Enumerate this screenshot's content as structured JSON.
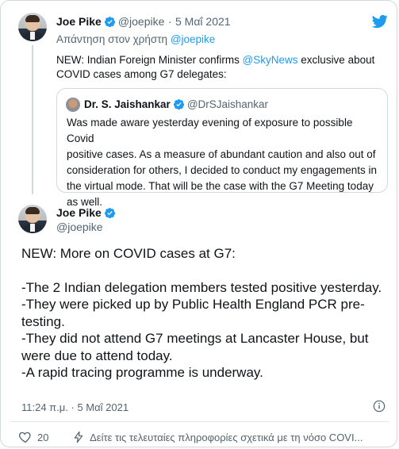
{
  "reply_tweet": {
    "author_name": "Joe Pike",
    "author_handle": "@joepike",
    "separator": "·",
    "date": "5 Μαΐ 2021",
    "reply_to_prefix": "Απάντηση στον χρήστη",
    "reply_to_handle": "@joepike",
    "text_before_mention": "NEW: Indian Foreign Minister confirms ",
    "mention": "@SkyNews",
    "text_after_mention": " exclusive about",
    "text_line2": "COVID cases among G7 delegates:"
  },
  "quoted_tweet": {
    "author_name": "Dr. S. Jaishankar",
    "author_handle": "@DrSJaishankar",
    "lines": [
      "Was made aware yesterday evening of exposure to possible Covid",
      "positive cases. As a measure of abundant caution and also out of",
      "consideration for others, I decided to conduct my engagements in",
      "the virtual mode. That will be the case with the G7 Meeting today",
      "as well."
    ]
  },
  "main_tweet": {
    "author_name": "Joe Pike",
    "author_handle": "@joepike",
    "heading": "NEW: More on COVID cases at G7:",
    "lines": [
      "-The 2 Indian delegation members tested positive yesterday.",
      "-They were picked up by Public Health England PCR pre-testing.",
      "-They did not attend G7 meetings at Lancaster House, but were due to attend today.",
      "-A rapid tracing programme is underway."
    ],
    "time": "11:24 π.μ.",
    "separator": "·",
    "date": "5 Μαΐ 2021"
  },
  "actions": {
    "like_count": "20",
    "news_link": "Δείτε τις τελευταίες πληροφορίες σχετικά με τη νόσο COVI..."
  },
  "colors": {
    "accent": "#1d9bf0",
    "text": "#0f1419",
    "muted": "#536471",
    "border": "#cfd9de"
  },
  "icons": [
    "twitter-bird-icon",
    "verified-badge-icon",
    "info-icon",
    "heart-icon",
    "lightning-icon"
  ]
}
